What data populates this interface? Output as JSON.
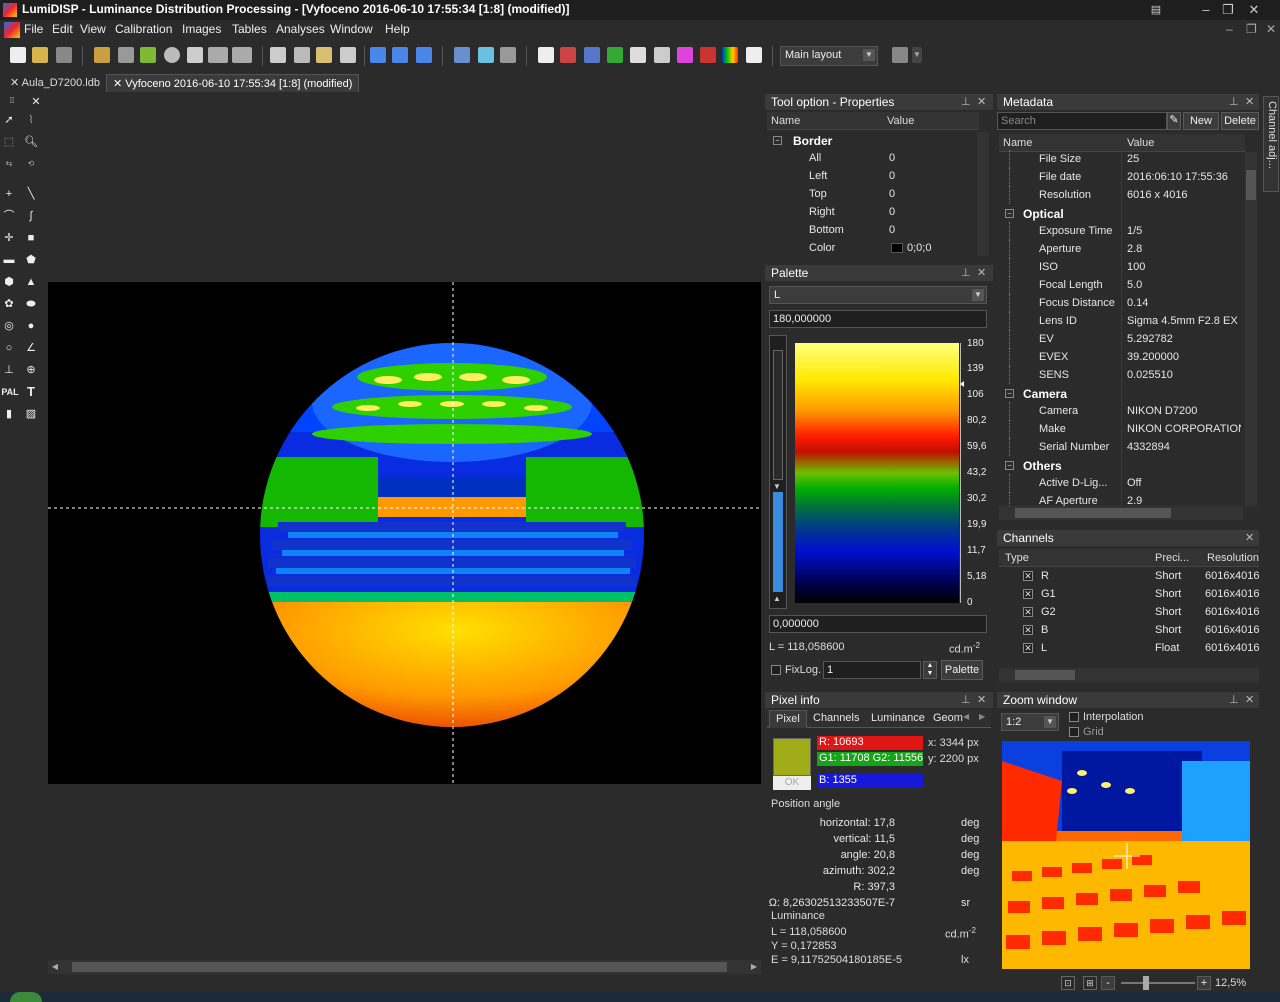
{
  "window": {
    "title": "LumiDISP - Luminance Distribution Processing - [Vyfoceno 2016-06-10 17:55:34 [1:8] (modified)]"
  },
  "menu": [
    "File",
    "Edit",
    "View",
    "Calibration",
    "Images",
    "Tables",
    "Analyses",
    "Window",
    "Help"
  ],
  "toolbar": {
    "layout": "Main layout"
  },
  "tabs": [
    {
      "label": "Aula_D7200.ldb"
    },
    {
      "label": "Vyfoceno 2016-06-10 17:55:34 [1:8] (modified)"
    }
  ],
  "tool_palette": {
    "pal_label": "PAL",
    "text_label": "T"
  },
  "properties": {
    "title": "Tool option - Properties",
    "col_name": "Name",
    "col_value": "Value",
    "group": "Border",
    "rows": [
      {
        "name": "All",
        "value": "0"
      },
      {
        "name": "Left",
        "value": "0"
      },
      {
        "name": "Top",
        "value": "0"
      },
      {
        "name": "Right",
        "value": "0"
      },
      {
        "name": "Bottom",
        "value": "0"
      },
      {
        "name": "Color",
        "value": "0;0;0"
      }
    ]
  },
  "palette": {
    "title": "Palette",
    "channel": "L",
    "max": "180,000000",
    "min": "0,000000",
    "luminance": "L = 118,058600",
    "unit": "cd.m",
    "unit_exp": "-2",
    "ticks": [
      "180",
      "139",
      "106",
      "80,2",
      "59,6",
      "43,2",
      "30,2",
      "19,9",
      "11,7",
      "5,18",
      "0"
    ],
    "fixlog_label": "FixLog.",
    "fixlog_value": "1",
    "palette_button": "Palette"
  },
  "metadata": {
    "title": "Metadata",
    "search_placeholder": "Search",
    "new_button": "New",
    "delete_button": "Delete",
    "col_name": "Name",
    "col_value": "Value",
    "rows": [
      {
        "type": "item",
        "name": "File Size",
        "value": "25"
      },
      {
        "type": "item",
        "name": "File date",
        "value": "2016:06:10 17:55:36"
      },
      {
        "type": "item",
        "name": "Resolution",
        "value": "6016 x 4016"
      },
      {
        "type": "group",
        "name": "Optical",
        "value": ""
      },
      {
        "type": "item",
        "name": "Exposure Time",
        "value": "1/5"
      },
      {
        "type": "item",
        "name": "Aperture",
        "value": "2.8"
      },
      {
        "type": "item",
        "name": "ISO",
        "value": "100"
      },
      {
        "type": "item",
        "name": "Focal Length",
        "value": "5.0"
      },
      {
        "type": "item",
        "name": "Focus Distance",
        "value": "0.14"
      },
      {
        "type": "item",
        "name": "Lens ID",
        "value": "Sigma 4.5mm F2.8 EX D"
      },
      {
        "type": "item",
        "name": "EV",
        "value": "5.292782"
      },
      {
        "type": "item",
        "name": "EVEX",
        "value": "39.200000"
      },
      {
        "type": "item",
        "name": "SENS",
        "value": "0.025510"
      },
      {
        "type": "group",
        "name": "Camera",
        "value": ""
      },
      {
        "type": "item",
        "name": "Camera",
        "value": "NIKON D7200"
      },
      {
        "type": "item",
        "name": "Make",
        "value": "NIKON CORPORATION"
      },
      {
        "type": "item",
        "name": "Serial Number",
        "value": "4332894"
      },
      {
        "type": "group",
        "name": "Others",
        "value": ""
      },
      {
        "type": "item",
        "name": "Active D-Lig...",
        "value": "Off"
      },
      {
        "type": "item",
        "name": "AF Aperture",
        "value": "2.9"
      }
    ]
  },
  "channels": {
    "title": "Channels",
    "col_type": "Type",
    "col_precision": "Preci...",
    "col_resolution": "Resolution",
    "rows": [
      {
        "name": "R",
        "precision": "Short",
        "resolution": "6016x4016"
      },
      {
        "name": "G1",
        "precision": "Short",
        "resolution": "6016x4016"
      },
      {
        "name": "G2",
        "precision": "Short",
        "resolution": "6016x4016"
      },
      {
        "name": "B",
        "precision": "Short",
        "resolution": "6016x4016"
      },
      {
        "name": "L",
        "precision": "Float",
        "resolution": "6016x4016"
      }
    ]
  },
  "pixel_info": {
    "title": "Pixel info",
    "tabs": [
      "Pixel",
      "Channels",
      "Luminance",
      "Geom"
    ],
    "r": "R: 10693",
    "g": "G1: 11708 G2: 11556",
    "b": "B: 1355",
    "ok": "OK",
    "x": "x: 3344 px",
    "y": "y: 2200 px",
    "swatch_color": "#a0ac18",
    "position_title": "Position angle",
    "position": [
      {
        "label": "horizontal: 17,8",
        "unit": "deg"
      },
      {
        "label": "vertical: 11,5",
        "unit": "deg"
      },
      {
        "label": "angle: 20,8",
        "unit": "deg"
      },
      {
        "label": "azimuth: 302,2",
        "unit": "deg"
      },
      {
        "label": "R: 397,3",
        "unit": ""
      },
      {
        "label": "Ω: 8,26302513233507E-7",
        "unit": "sr"
      }
    ],
    "luminance_title": "Luminance",
    "l": "L = 118,058600",
    "l_unit": "cd.m",
    "l_unit_exp": "-2",
    "y_val": "Y = 0,172853",
    "e_val": "E = 9,11752504180185E-5",
    "e_unit": "lx"
  },
  "zoom_window": {
    "title": "Zoom window",
    "zoom": "1:2",
    "interpolation": "Interpolation",
    "grid": "Grid",
    "zoom_percent": "12,5%",
    "minus": "-",
    "plus": "+"
  },
  "side_tab": {
    "label": "Channel adj..."
  }
}
